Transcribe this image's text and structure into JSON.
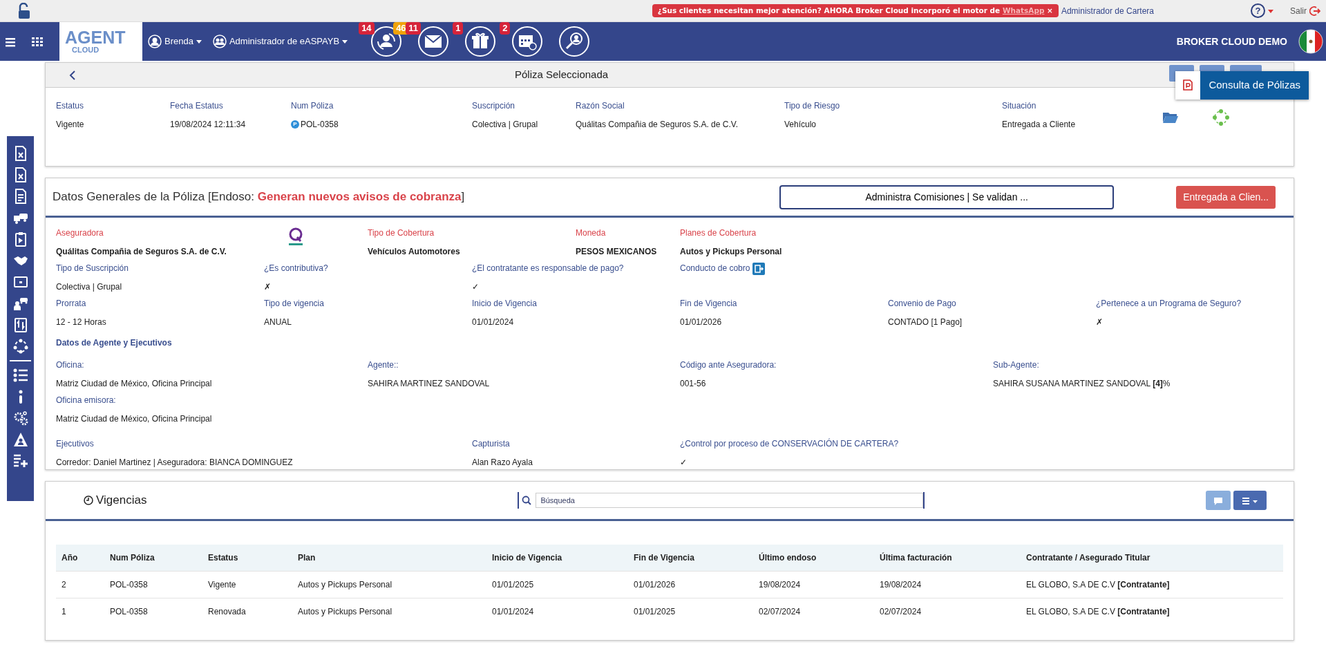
{
  "top_bar": {
    "banner": {
      "text": "¿Sus clientes necesitan mejor atención? AHORA Broker Cloud incorporó el motor de ",
      "link": "WhatsApp",
      "close": "×"
    },
    "admin_link": "Administrador de Cartera",
    "help": "?",
    "logout": "Salir"
  },
  "navbar": {
    "logo": {
      "line_1": "AGENT",
      "line_2": "CLOUD"
    },
    "user_menu": "Brenda",
    "role_menu": "Administrador de eASPAYB",
    "icon_buttons": [
      {
        "kind": "renewals",
        "badges": [
          {
            "text": "14",
            "color": "#d6243a"
          },
          {
            "text": "46",
            "color": "#f0a30a"
          }
        ]
      },
      {
        "kind": "mail",
        "badges": [
          {
            "text": "11",
            "color": "#d6243a"
          }
        ]
      },
      {
        "kind": "gift",
        "badges": [
          {
            "text": "1",
            "color": "#d6243a"
          }
        ]
      },
      {
        "kind": "calendar",
        "badges": [
          {
            "text": "2",
            "color": "#d6243a"
          }
        ]
      },
      {
        "kind": "user-search"
      }
    ],
    "brand": "BROKER CLOUD DEMO"
  },
  "policy": {
    "title": "Póliza Seleccionada",
    "tooltip": "Consulta de Pólizas",
    "fields": [
      {
        "label": "Estatus",
        "value": "Vigente"
      },
      {
        "label": "Fecha Estatus",
        "value": "19/08/2024 12:11:34"
      },
      {
        "label": "Num Póliza",
        "value": "POL-0358",
        "badge": "P"
      },
      {
        "label": "Suscripción",
        "value": "Colectiva | Grupal"
      },
      {
        "label": "Razón Social",
        "value": "Quálitas Compañia de Seguros S.A. de C.V."
      },
      {
        "label": "Tipo de Riesgo",
        "value": "Vehículo"
      },
      {
        "label": "Situación",
        "value": "Entregada a Cliente"
      }
    ]
  },
  "general": {
    "title": "Datos Generales de la Póliza [Endoso: ",
    "endoso": "Generan nuevos avisos de cobranza",
    "title_end": "]",
    "commission_button": "Administra Comisiones | Se validan ...",
    "status_button": "Entregada a Clien...",
    "main_fields": [
      {
        "label": "Aseguradora",
        "value": "Quálitas Compañia de Seguros S.A. de C.V.",
        "accent": true
      },
      {
        "label": "Tipo de Cobertura",
        "value": "Vehículos Automotores",
        "accent": true
      },
      {
        "label": "Moneda",
        "value": "PESOS MEXICANOS",
        "accent": true
      },
      {
        "label": "Planes de Cobertura",
        "value": "Autos y Pickups Personal",
        "accent": true
      }
    ],
    "rows": [
      [
        {
          "label": "Tipo de Suscripción",
          "value": "Colectiva | Grupal"
        },
        {
          "label": "¿Es contributiva?",
          "value": "✗"
        },
        {
          "label": "¿El contratante es responsable de pago?",
          "value": "✓"
        },
        {
          "label": "Conducto de cobro",
          "kind": "action"
        }
      ],
      [
        {
          "label": "Prorrata",
          "value": "12 - 12 Horas"
        },
        {
          "label": "Tipo de vigencia",
          "value": "ANUAL"
        },
        {
          "label": "Inicio de Vigencia",
          "value": "01/01/2024"
        },
        {
          "label": "Fin de Vigencia",
          "value": "01/01/2026"
        },
        {
          "label": "Convenio de Pago",
          "value": "CONTADO [1 Pago]"
        },
        {
          "label": "¿Pertenece a un Programa de Seguro?",
          "value": "✗"
        }
      ]
    ],
    "agent_section": "Datos de Agente y Ejecutivos",
    "agent_fields": [
      {
        "label": "Oficina:",
        "value": "Matriz Ciudad de México, Oficina Principal"
      },
      {
        "label": "Agente::",
        "value": "SAHIRA MARTINEZ SANDOVAL"
      },
      {
        "label": "Código ante Aseguradora:",
        "value": "001-56"
      },
      {
        "label": "Sub-Agente:",
        "value": "SAHIRA SUSANA MARTINEZ SANDOVAL **[4]**%"
      }
    ],
    "issuing_office": {
      "label": "Oficina emisora:",
      "value": "Matriz Ciudad de México, Oficina Principal"
    },
    "staff_fields": [
      {
        "label": "Ejecutivos",
        "value": "Corredor: Daniel Martinez | Aseguradora: BIANCA DOMINGUEZ"
      },
      {
        "label": "Capturista",
        "value": "Alan Razo Ayala"
      },
      {
        "label": "¿Control por proceso de CONSERVACIÓN DE CARTERA?",
        "value": "✓"
      }
    ]
  },
  "vigencias": {
    "title": "Vigencias",
    "search": {
      "placeholder": "Búsqueda"
    },
    "table": {
      "columns": [
        "Año",
        "Num Póliza",
        "Estatus",
        "Plan",
        "Inicio de Vigencia",
        "Fin de Vigencia",
        "Último endoso",
        "Última facturación",
        "Contratante / Asegurado Titular"
      ],
      "rows": [
        [
          "2",
          "POL-0358",
          "Vigente",
          "Autos y Pickups Personal",
          "01/01/2025",
          "01/01/2026",
          "19/08/2024",
          "19/08/2024",
          "EL GLOBO, S.A DE C.V **[Contratante]**"
        ],
        [
          "1",
          "POL-0358",
          "Renovada",
          "Autos y Pickups Personal",
          "01/01/2024",
          "01/01/2025",
          "02/07/2024",
          "02/07/2024",
          "EL GLOBO, S.A DE C.V **[Contratante]**"
        ]
      ]
    }
  }
}
